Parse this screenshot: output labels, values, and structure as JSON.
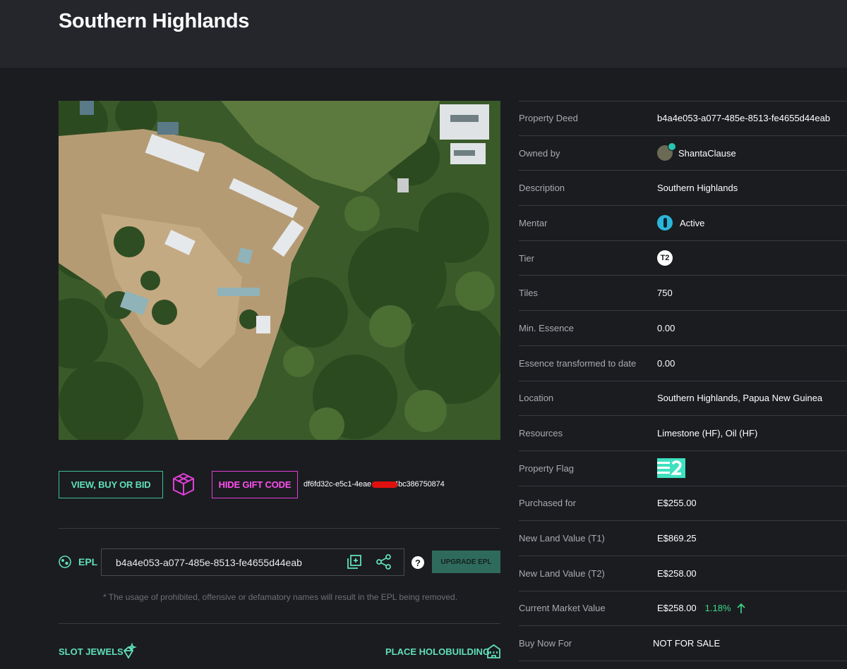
{
  "header": {
    "title": "Southern Highlands"
  },
  "actions": {
    "view_buy_bid": "VIEW, BUY OR BID",
    "hide_gift_code": "HIDE GIFT CODE",
    "gift_code_prefix": "df6fd32c-e5c1-4eae",
    "gift_code_suffix": "4bc386750874"
  },
  "epl": {
    "label": "EPL",
    "value": "b4a4e053-a077-485e-8513-fe4655d44eab",
    "upgrade_label": "UPGRADE EPL",
    "help": "?",
    "notice": "* The usage of prohibited, offensive or defamatory names will result in the EPL being removed."
  },
  "bottom": {
    "slot_jewels": "SLOT JEWELS",
    "place_holobuilding": "PLACE HOLOBUILDING"
  },
  "property": {
    "deed_label": "Property Deed",
    "deed": "b4a4e053-a077-485e-8513-fe4655d44eab",
    "owner_label": "Owned by",
    "owner": "ShantaClause",
    "description_label": "Description",
    "description": "Southern Highlands",
    "mentar_label": "Mentar",
    "mentar": "Active",
    "tier_label": "Tier",
    "tier": "T2",
    "tiles_label": "Tiles",
    "tiles": "750",
    "min_essence_label": "Min. Essence",
    "min_essence": "0.00",
    "essence_transformed_label": "Essence transformed to date",
    "essence_transformed": "0.00",
    "location_label": "Location",
    "location": "Southern Highlands, Papua New Guinea",
    "resources_label": "Resources",
    "resources": "Limestone (HF), Oil (HF)",
    "flag_label": "Property Flag",
    "purchased_label": "Purchased for",
    "purchased": "E$255.00",
    "new_t1_label": "New Land Value (T1)",
    "new_t1": "E$869.25",
    "new_t2_label": "New Land Value (T2)",
    "new_t2": "E$258.00",
    "market_label": "Current Market Value",
    "market": "E$258.00",
    "market_change": "1.18%",
    "buy_now_label": "Buy Now For",
    "buy_now": "NOT FOR SALE"
  },
  "colors": {
    "accent_green": "#5fe0b5",
    "accent_pink": "#ff4ff0",
    "positive": "#3fd98a"
  }
}
